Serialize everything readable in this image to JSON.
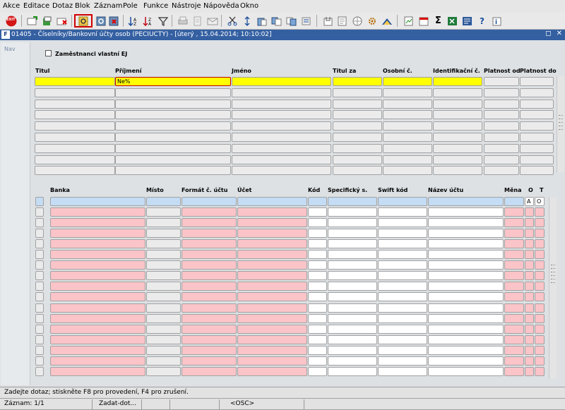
{
  "menu": [
    "Akce",
    "Editace",
    "Dotaz",
    "Blok",
    "Záznam",
    "Pole",
    "Funkce",
    "Nástroje",
    "Nápověda",
    "Okno"
  ],
  "window": {
    "title": "01405 - Číselníky/Bankovní účty osob (PECIUCTY) - [úterý  , 15.04.2014; 10:10:02]",
    "app_icon_text": "F",
    "controls": "◻ ✕"
  },
  "nav": {
    "label": "Nav"
  },
  "top_block": {
    "checkbox_label": "Zaměstnanci vlastní EJ",
    "headers": [
      "Titul",
      "Příjmení",
      "Jméno",
      "Titul za",
      "Osobní č.",
      "Identifikační č.",
      "Platnost od",
      "Platnost do"
    ],
    "query_value": "Ne%"
  },
  "bottom_block": {
    "headers": [
      "Banka",
      "Místo",
      "Formát č. účtu",
      "Účet",
      "Kód",
      "Specifický s.",
      "Swift kód",
      "Název účtu",
      "Měna",
      "O",
      "T"
    ],
    "first_row_values": [
      "A",
      "O"
    ]
  },
  "status": {
    "message": "Zadejte dotaz; stiskněte F8 pro provedení, F4 pro zrušení.",
    "record": "Záznam: 1/1",
    "mode": "Zadat-dot...",
    "osc": "<OSC>"
  },
  "toolbar": {
    "exit_label": "EXIT",
    "sigma": "Σ",
    "help": "?"
  },
  "colors": {
    "titlebar": "#3460a2",
    "query_field": "#ffff00",
    "required_field": "#fbc4c8",
    "current_row": "#c4dcf4"
  }
}
